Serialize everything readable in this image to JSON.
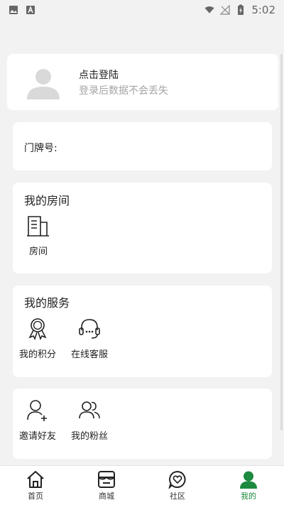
{
  "status_bar": {
    "time": "5:02",
    "icons": [
      "image-icon",
      "text-a-icon",
      "wifi-icon",
      "no-signal-icon",
      "battery-charging-icon"
    ]
  },
  "login": {
    "title": "点击登陆",
    "subtitle": "登录后数据不会丢失"
  },
  "door": {
    "label": "门牌号:"
  },
  "room": {
    "title": "我的房间",
    "items": [
      {
        "label": "房间",
        "icon": "building-icon"
      }
    ]
  },
  "service": {
    "title": "我的服务",
    "items": [
      {
        "label": "我的积分",
        "icon": "medal-icon"
      },
      {
        "label": "在线客服",
        "icon": "headset-icon"
      }
    ]
  },
  "friends": {
    "items": [
      {
        "label": "邀请好友",
        "icon": "add-user-icon"
      },
      {
        "label": "我的粉丝",
        "icon": "users-icon"
      }
    ]
  },
  "tabbar": {
    "active_color": "#1d8a3f",
    "tabs": [
      {
        "label": "首页",
        "icon": "home-icon"
      },
      {
        "label": "商城",
        "icon": "store-icon"
      },
      {
        "label": "社区",
        "icon": "heart-chat-icon"
      },
      {
        "label": "我的",
        "icon": "person-icon"
      }
    ],
    "active_index": 3
  }
}
